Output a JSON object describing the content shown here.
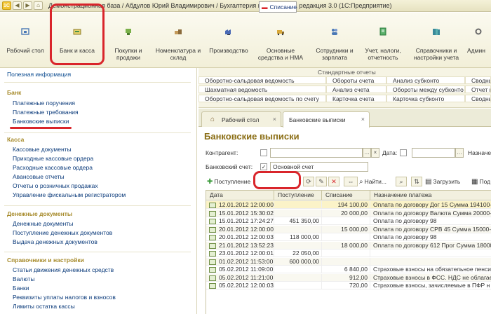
{
  "window": {
    "title": "Демонстрационная база / Абдулов Юрий Владимирович / Бухгалтерия предприятия, редакция 3.0  (1С:Предприятие)"
  },
  "sections": [
    {
      "id": "desktop",
      "label": "Рабочий стол",
      "icon": "house-icon",
      "color": "#4a78b5"
    },
    {
      "id": "bank",
      "label": "Банк и касса",
      "icon": "bank-icon",
      "color": "#4a8f4a"
    },
    {
      "id": "sales",
      "label": "Покупки и продажи",
      "icon": "cart-icon",
      "color": "#6a9a3a"
    },
    {
      "id": "nomenclature",
      "label": "Номенклатура и склад",
      "icon": "boxes-icon",
      "color": "#8a6a3a"
    },
    {
      "id": "production",
      "label": "Производство",
      "icon": "factory-icon",
      "color": "#4a6ab5"
    },
    {
      "id": "assets",
      "label": "Основные средства и НМА",
      "icon": "truck-icon",
      "color": "#b58a2a"
    },
    {
      "id": "staff",
      "label": "Сотрудники и зарплата",
      "icon": "people-icon",
      "color": "#4a78b5"
    },
    {
      "id": "taxes",
      "label": "Учет, налоги, отчетность",
      "icon": "ledger-icon",
      "color": "#3a9a5a"
    },
    {
      "id": "references",
      "label": "Справочники и настройки учета",
      "icon": "books-icon",
      "color": "#3a8a9a"
    },
    {
      "id": "admin",
      "label": "Админ",
      "icon": "tools-icon",
      "color": "#6a6a6a"
    }
  ],
  "leftnav": {
    "top_link": "Полезная информация",
    "groups": [
      {
        "heading": "Банк",
        "items": [
          "Платежные поручения",
          "Платежные требования",
          "Банковские выписки"
        ]
      },
      {
        "heading": "Касса",
        "items": [
          "Кассовые документы",
          "Приходные кассовые ордера",
          "Расходные кассовые ордера",
          "Авансовые отчеты",
          "Отчеты о розничных продажах",
          "Управление фискальным регистратором"
        ]
      },
      {
        "heading": "Денежные документы",
        "items": [
          "Денежные документы",
          "Поступление денежных документов",
          "Выдача денежных документов"
        ]
      },
      {
        "heading": "Справочники и настройки",
        "items": [
          "Статьи движения денежных средств",
          "Валюты",
          "Банки",
          "Реквизиты уплаты налогов и взносов",
          "Лимиты остатка кассы"
        ]
      }
    ]
  },
  "reports": {
    "title": "Стандартные отчеты",
    "rows": [
      [
        "Оборотно-сальдовая ведомость",
        "Обороты счета",
        "Анализ субконто",
        "Сводны"
      ],
      [
        "Шахматная ведомость",
        "Анализ счета",
        "Обороты между субконто",
        "Отчет по"
      ],
      [
        "Оборотно-сальдовая ведомость по счету",
        "Карточка счета",
        "Карточка субконто",
        "Сводны"
      ]
    ]
  },
  "tabs": [
    {
      "label": "Рабочий стол",
      "active": false
    },
    {
      "label": "Банковские выписки",
      "active": true
    }
  ],
  "form": {
    "title": "Банковские выписки",
    "counterparty_label": "Контрагент:",
    "counterparty_value": "",
    "date_label": "Дата:",
    "date_value": "",
    "purpose_label": "Назначен",
    "bank_account_label": "Банковский счет:",
    "bank_account_checked": true,
    "bank_account_value": "Основной счет"
  },
  "commands": {
    "receipt": "Поступление",
    "writeoff": "Списание",
    "find": "Найти...",
    "load": "Загрузить",
    "more": "Под"
  },
  "table": {
    "columns": [
      "Дата",
      "Поступление",
      "Списание",
      "Назначение платежа"
    ],
    "rows": [
      {
        "date": "12.01.2012 12:00:00",
        "in": "",
        "out": "194 100,00",
        "purpose": "Оплата по договору Дог 15 Сумма 194100-00",
        "selected": true
      },
      {
        "date": "15.01.2012 15:30:02",
        "in": "",
        "out": "20 000,00",
        "purpose": "Оплата по договору Валюта Сумма 20000-00"
      },
      {
        "date": "15.01.2012 17:24:27",
        "in": "451 350,00",
        "out": "",
        "purpose": "Оплата по договору 98"
      },
      {
        "date": "20.01.2012 12:00:00",
        "in": "",
        "out": "15 000,00",
        "purpose": "Оплата по договору СРВ 45 Сумма 15000-00"
      },
      {
        "date": "20.01.2012 12:00:03",
        "in": "118 000,00",
        "out": "",
        "purpose": "Оплата по договору 98"
      },
      {
        "date": "21.01.2012 13:52:23",
        "in": "",
        "out": "18 000,00",
        "purpose": "Оплата по договору 612 Прог Сумма 18000-00"
      },
      {
        "date": "23.01.2012 12:00:01",
        "in": "22 050,00",
        "out": "",
        "purpose": ""
      },
      {
        "date": "01.02.2012 11:53:00",
        "in": "600 000,00",
        "out": "",
        "purpose": ""
      },
      {
        "date": "05.02.2012 11:09:00",
        "in": "",
        "out": "6 840,00",
        "purpose": "Страховые взносы на обязательное пенсио"
      },
      {
        "date": "05.02.2012 11:21:00",
        "in": "",
        "out": "912,00",
        "purpose": "Страховые взносы в ФСС. НДС не облагае"
      },
      {
        "date": "05.02.2012 12:00:03",
        "in": "",
        "out": "720,00",
        "purpose": "Страховые взносы, зачисляемые в ПФР н"
      }
    ]
  }
}
